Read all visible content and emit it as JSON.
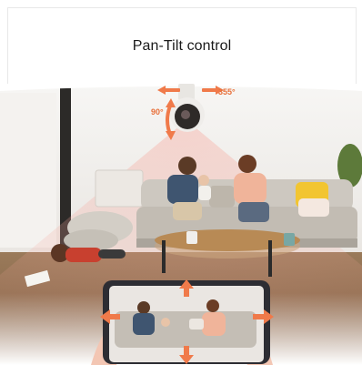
{
  "title": "Pan-Tilt control",
  "camera": {
    "pan_angle_label": "355°",
    "tilt_angle_label": "90°"
  },
  "colors": {
    "accent_arrow": "#f07a4a",
    "beam": "#f4b5ad",
    "sofa": "#c9c4bc",
    "pillow_yellow": "#f2c531",
    "floor": "#8a6a4d",
    "wall": "#f1efed"
  },
  "icons": [
    "pan-arrow-icon",
    "tilt-arrow-icon",
    "direction-up-icon",
    "direction-down-icon",
    "direction-left-icon",
    "direction-right-icon"
  ]
}
